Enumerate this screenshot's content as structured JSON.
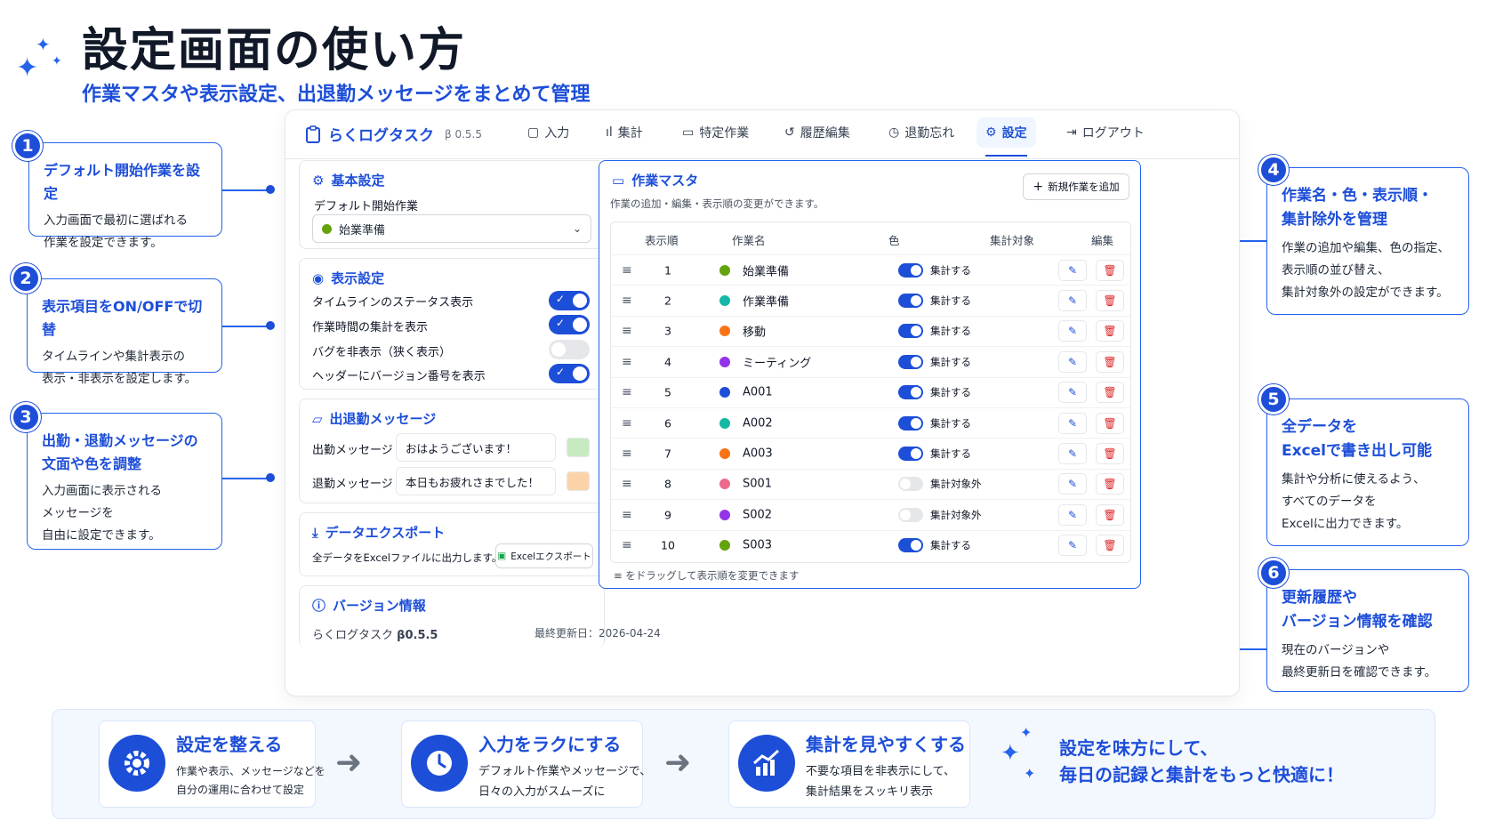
{
  "header": {
    "title": "設定画面の使い方",
    "subtitle": "作業マスタや表示設定、出退勤メッセージをまとめて管理"
  },
  "callouts": [
    {
      "num": "1",
      "title": "デフォルト開始作業を設定",
      "body": [
        "入力画面で最初に選ばれる",
        "作業を設定できます。"
      ]
    },
    {
      "num": "2",
      "title": "表示項目をON/OFFで切替",
      "body": [
        "タイムラインや集計表示の",
        "表示・非表示を設定します。"
      ]
    },
    {
      "num": "3",
      "title": [
        "出勤・退勤メッセージの",
        "文面や色を調整"
      ],
      "body": [
        "入力画面に表示される",
        "メッセージを",
        "自由に設定できます。"
      ]
    },
    {
      "num": "4",
      "title": [
        "作業名・色・表示順・",
        "集計除外を管理"
      ],
      "body": [
        "作業の追加や編集、色の指定、",
        "表示順の並び替え、",
        "集計対象外の設定ができます。"
      ]
    },
    {
      "num": "5",
      "title": [
        "全データを",
        "Excelで書き出し可能"
      ],
      "body": [
        "集計や分析に使えるよう、",
        "すべてのデータを",
        "Excelに出力できます。"
      ]
    },
    {
      "num": "6",
      "title": [
        "更新履歴や",
        "バージョン情報を確認"
      ],
      "body": [
        "現在のバージョンや",
        "最終更新日を確認できます。"
      ]
    }
  ],
  "app": {
    "brand": "らくログタスク",
    "version": "β 0.5.5",
    "nav": [
      {
        "label": "入力",
        "icon": "clipboard-icon"
      },
      {
        "label": "集計",
        "icon": "bar-chart-icon"
      },
      {
        "label": "特定作業",
        "icon": "book-icon"
      },
      {
        "label": "履歴編集",
        "icon": "history-icon"
      },
      {
        "label": "退勤忘れ",
        "icon": "clock-icon"
      },
      {
        "label": "設定",
        "icon": "gear-icon",
        "active": true
      },
      {
        "label": "ログアウト",
        "icon": "logout-icon"
      }
    ],
    "basic": {
      "title": "基本設定",
      "label": "デフォルト開始作業",
      "selected": "始業準備",
      "selected_color": "#65a30d"
    },
    "display": {
      "title": "表示設定",
      "items": [
        {
          "label": "タイムラインのステータス表示",
          "on": true
        },
        {
          "label": "作業時間の集計を表示",
          "on": true
        },
        {
          "label": "バグを非表示（狭く表示）",
          "on": false
        },
        {
          "label": "ヘッダーにバージョン番号を表示",
          "on": true
        }
      ]
    },
    "messages": {
      "title": "出退勤メッセージ",
      "clock_in_label": "出勤メッセージ",
      "clock_in_value": "おはようございます！",
      "clock_in_color": "#c8eac0",
      "clock_out_label": "退勤メッセージ",
      "clock_out_value": "本日もお疲れさまでした！",
      "clock_out_color": "#fcd3a8"
    },
    "export": {
      "title": "データエクスポート",
      "desc": "全データをExcelファイルに出力します。",
      "button": "Excelエクスポート"
    },
    "version_info": {
      "title": "バージョン情報",
      "app": "らくログタスク",
      "version": "β0.5.5",
      "updated": "最終更新日：2026-04-24"
    },
    "master": {
      "title": "作業マスタ",
      "desc": "作業の追加・編集・表示順の変更ができます。",
      "add_button": "新規作業を追加",
      "columns": [
        "表示順",
        "作業名",
        "色",
        "集計対象",
        "編集"
      ],
      "rows": [
        {
          "order": "1",
          "name": "始業準備",
          "color": "#65a30d",
          "agg": true,
          "agg_label": "集計する"
        },
        {
          "order": "2",
          "name": "作業準備",
          "color": "#14b8a6",
          "agg": true,
          "agg_label": "集計する"
        },
        {
          "order": "3",
          "name": "移動",
          "color": "#f97316",
          "agg": true,
          "agg_label": "集計する"
        },
        {
          "order": "4",
          "name": "ミーティング",
          "color": "#9333ea",
          "agg": true,
          "agg_label": "集計する"
        },
        {
          "order": "5",
          "name": "A001",
          "color": "#1d4ed8",
          "agg": true,
          "agg_label": "集計する"
        },
        {
          "order": "6",
          "name": "A002",
          "color": "#14b8a6",
          "agg": true,
          "agg_label": "集計する"
        },
        {
          "order": "7",
          "name": "A003",
          "color": "#f97316",
          "agg": true,
          "agg_label": "集計する"
        },
        {
          "order": "8",
          "name": "S001",
          "color": "#ec6b8d",
          "agg": false,
          "agg_label": "集計対象外"
        },
        {
          "order": "9",
          "name": "S002",
          "color": "#9333ea",
          "agg": false,
          "agg_label": "集計対象外"
        },
        {
          "order": "10",
          "name": "S003",
          "color": "#65a30d",
          "agg": true,
          "agg_label": "集計する"
        }
      ],
      "footer": "をドラッグして表示順を変更できます"
    }
  },
  "benefits": [
    {
      "title": "設定を整える",
      "body": [
        "作業や表示、メッセージなどを",
        "自分の運用に合わせて設定"
      ],
      "icon": "gear-icon"
    },
    {
      "title": "入力をラクにする",
      "body": [
        "デフォルト作業やメッセージで、",
        "日々の入力がスムーズに"
      ],
      "icon": "clock-icon"
    },
    {
      "title": "集計を見やすくする",
      "body": [
        "不要な項目を非表示にして、",
        "集計結果をスッキリ表示"
      ],
      "icon": "chart-icon"
    }
  ],
  "slogan": [
    "設定を味方にして、",
    "毎日の記録と集計をもっと快適に！"
  ],
  "colors": {
    "accent": "#1d4ed8",
    "danger": "#dc2626"
  }
}
